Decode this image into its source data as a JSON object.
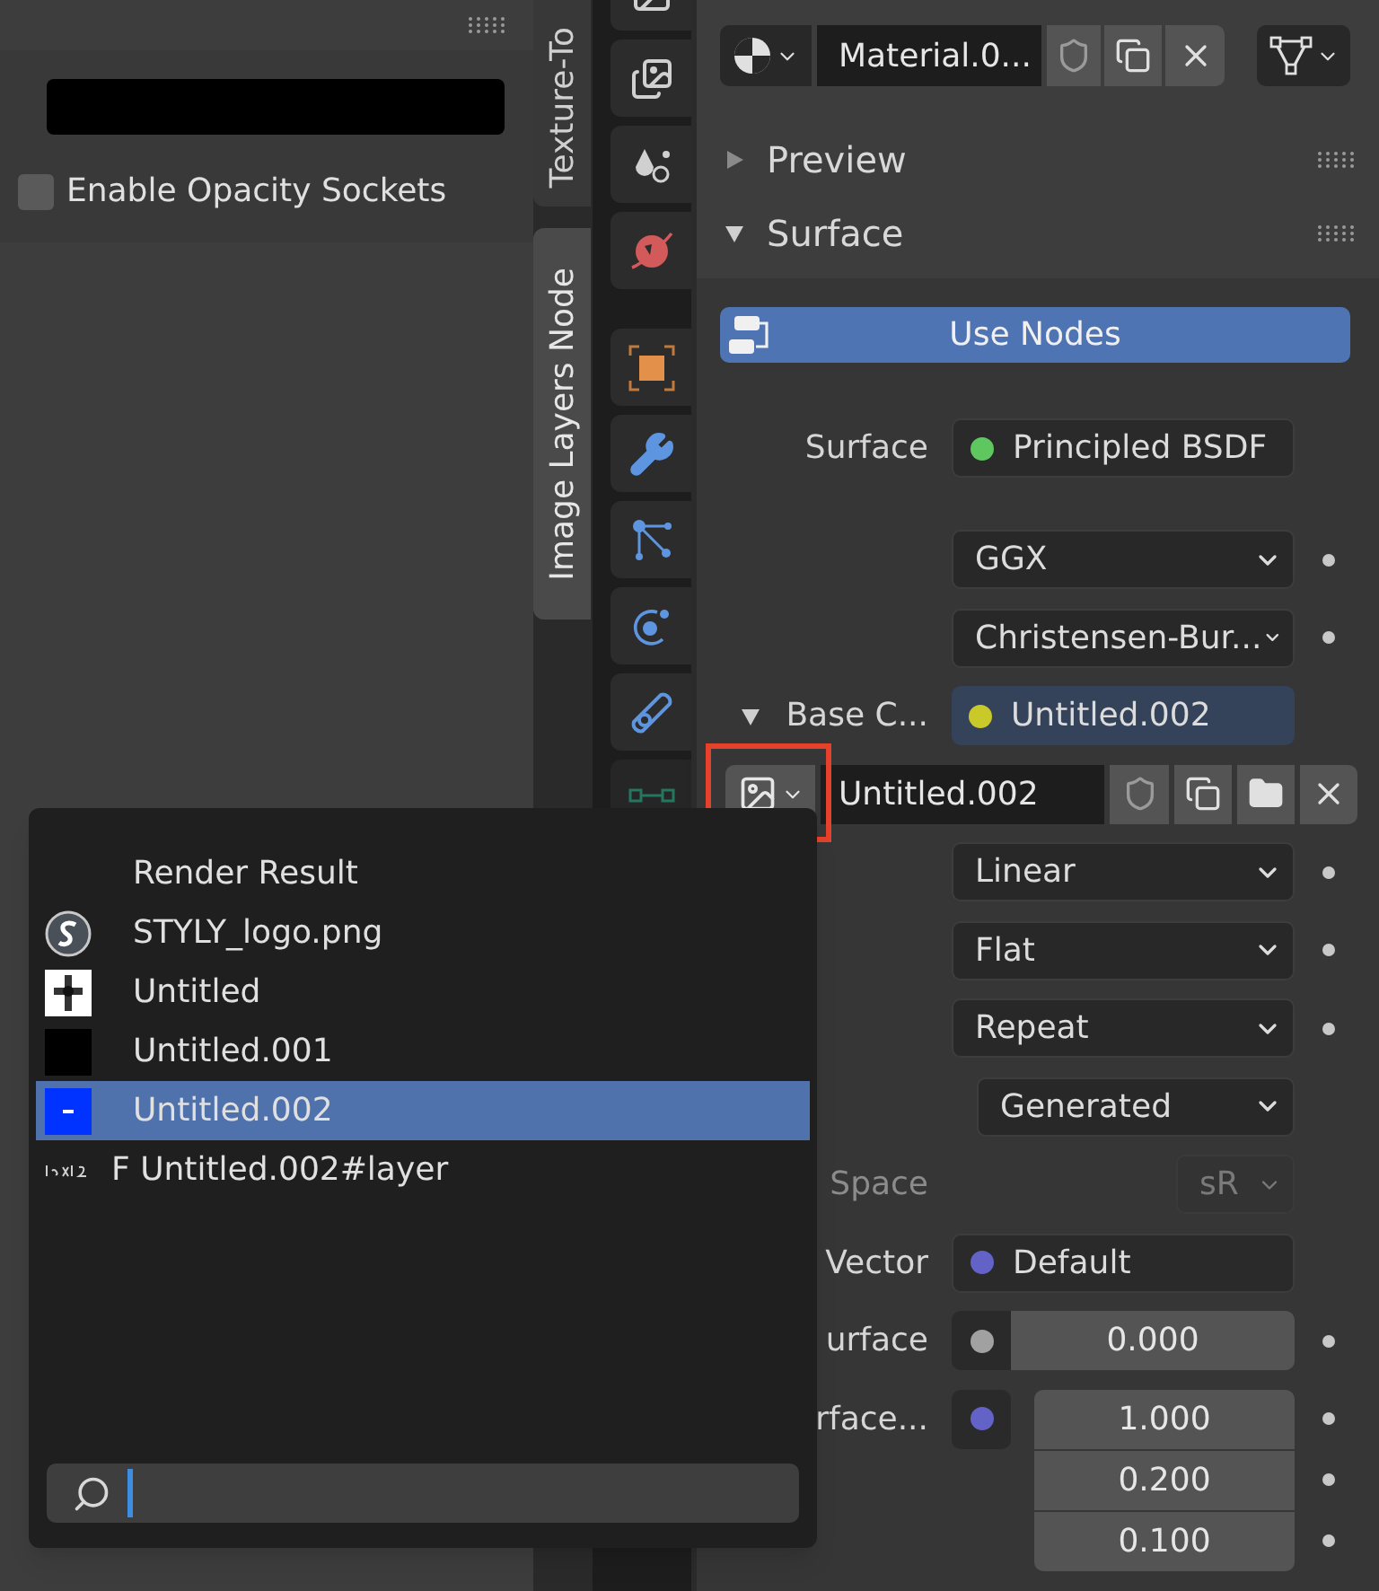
{
  "left_panel": {
    "checkbox": {
      "label": "Enable Opacity Sockets",
      "checked": false
    }
  },
  "side_tabs": [
    {
      "label": "Texture-To",
      "selected": false
    },
    {
      "label": "Image Layers Node",
      "selected": true
    }
  ],
  "material_slot": {
    "name": "Material.0..."
  },
  "panels": [
    {
      "title": "Preview",
      "expanded": false
    },
    {
      "title": "Surface",
      "expanded": true
    }
  ],
  "use_nodes": {
    "label": "Use Nodes",
    "on": true
  },
  "rows": [
    {
      "kind": "socket",
      "label": "Surface",
      "value": "Principled BSDF",
      "color": "#5fc75f"
    },
    {
      "kind": "dropdown",
      "value": "GGX",
      "keyframe": true
    },
    {
      "kind": "dropdown",
      "value": "Christensen-Bur...",
      "keyframe": true
    },
    {
      "kind": "linked",
      "label": "Base C...",
      "value": "Untitled.002",
      "color": "#c9c92a",
      "expanded": true
    },
    {
      "kind": "image",
      "value": "Untitled.002"
    },
    {
      "kind": "dropdown",
      "value": "Linear",
      "keyframe": true
    },
    {
      "kind": "dropdown",
      "value": "Flat",
      "keyframe": true
    },
    {
      "kind": "dropdown",
      "value": "Repeat",
      "keyframe": true
    },
    {
      "kind": "subdropdown",
      "value": "Generated",
      "keyframe": false
    },
    {
      "kind": "colorspace",
      "label": "Space",
      "value": "sR",
      "disabled": true
    },
    {
      "kind": "socket",
      "label": "Vector",
      "value": "Default",
      "color": "#6363c7"
    },
    {
      "kind": "number",
      "label": "urface",
      "value": "0.000",
      "color": "#a1a1a1",
      "keyframe": true
    },
    {
      "kind": "vector",
      "label": "rface...",
      "color": "#6363c7",
      "values": [
        "1.000",
        "0.200",
        "0.100"
      ],
      "keyframe": true
    }
  ],
  "image_menu": {
    "items": [
      {
        "label": "Render Result",
        "kind": "none",
        "selected": false
      },
      {
        "label": "STYLY_logo.png",
        "kind": "logo",
        "selected": false
      },
      {
        "label": "Untitled",
        "kind": "pattern",
        "selected": false
      },
      {
        "label": "Untitled.001",
        "kind": "black",
        "selected": false
      },
      {
        "label": "Untitled.002",
        "kind": "blue",
        "selected": true
      },
      {
        "label": "F Untitled.002#layer",
        "kind": "text",
        "selected": false
      }
    ]
  }
}
